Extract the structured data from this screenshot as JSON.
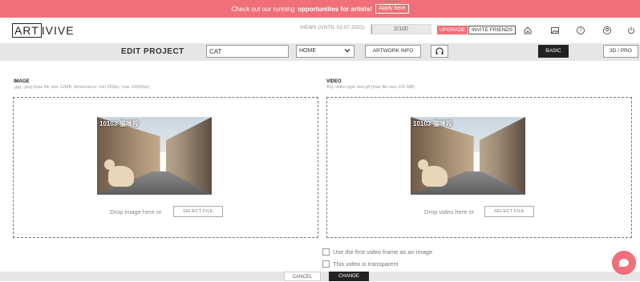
{
  "banner": {
    "text_before": "Check out our running",
    "text_bold": "opportunities for artists!",
    "apply_label": "Apply here"
  },
  "header": {
    "logo_boxed": "ART",
    "logo_rest": "IVIVE",
    "views_label": "VIEWS (UNTIL 03.07.2022)",
    "views_value": "2/100",
    "views_fraction": 0.02,
    "upgrade_label": "UPGRADE",
    "invite_label": "INVITE FRIENDS",
    "icons": [
      "home-icon",
      "gallery-icon",
      "help-icon",
      "account-icon",
      "power-icon"
    ]
  },
  "toolbar": {
    "title": "EDIT PROJECT",
    "name_value": "CAT",
    "select_value": "HOME",
    "artwork_info_label": "ARTWORK INFO",
    "basic_label": "BASIC",
    "pro_label": "3D / PRO"
  },
  "image_section": {
    "label": "IMAGE",
    "hint": ".jpg, .png (max file size 12MB, dimensions: min 320px, max 10000px)",
    "watermark": "10103-猫咪视",
    "drop_text": "Drop image here or",
    "select_label": "SELECT FILE"
  },
  "video_section": {
    "label": "VIDEO",
    "hint": "Any video type and gif (max file size 100 MB)",
    "watermark": "10103-猫咪视",
    "drop_text": "Drop video here or",
    "select_label": "SELECT FILE"
  },
  "options": {
    "first_frame_label": "Use the first video frame as an image",
    "transparent_label": "This video is transparent"
  },
  "footer": {
    "cancel_label": "CANCEL",
    "change_label": "CHANGE"
  },
  "colors": {
    "accent": "#f06f78",
    "dark": "#222222",
    "progress": "#7fbf3f"
  }
}
